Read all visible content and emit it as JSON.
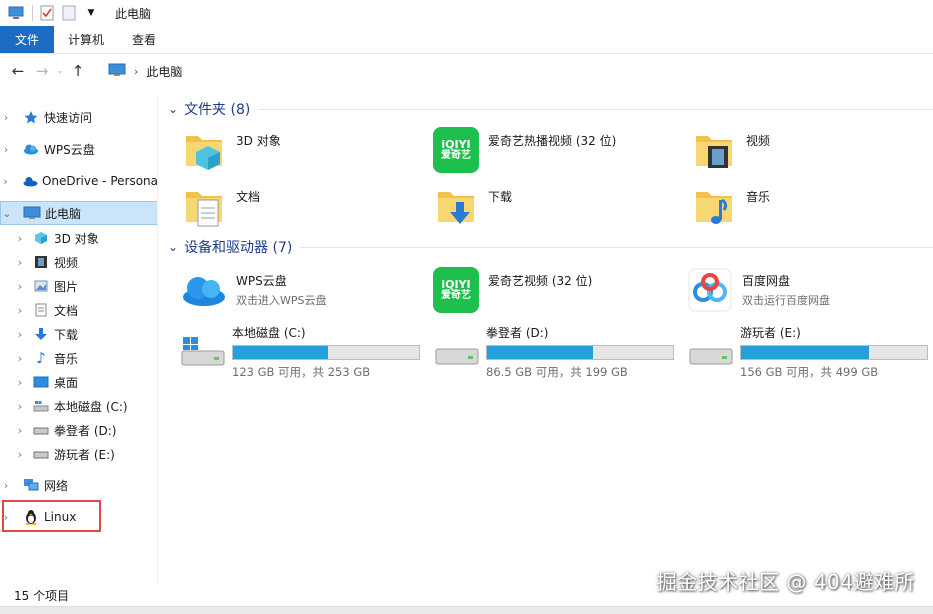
{
  "titlebar": {
    "title": "此电脑"
  },
  "ribbon": {
    "tabs": [
      "文件",
      "计算机",
      "查看"
    ]
  },
  "address": {
    "crumb": "此电脑"
  },
  "nav": {
    "items": [
      {
        "label": "快速访问"
      },
      {
        "label": "WPS云盘"
      },
      {
        "label": "OneDrive - Persona"
      },
      {
        "label": "此电脑"
      },
      {
        "label": "3D 对象"
      },
      {
        "label": "视频"
      },
      {
        "label": "图片"
      },
      {
        "label": "文档"
      },
      {
        "label": "下载"
      },
      {
        "label": "音乐"
      },
      {
        "label": "桌面"
      },
      {
        "label": "本地磁盘 (C:)"
      },
      {
        "label": "拳登者 (D:)"
      },
      {
        "label": "游玩者 (E:)"
      },
      {
        "label": "网络"
      },
      {
        "label": "Linux"
      }
    ]
  },
  "folders": {
    "title": "文件夹 (8)",
    "items": [
      {
        "label": "3D 对象"
      },
      {
        "label": "爱奇艺热播视频 (32 位)"
      },
      {
        "label": "视频"
      },
      {
        "label": "文档"
      },
      {
        "label": "下载"
      },
      {
        "label": "音乐"
      }
    ]
  },
  "devices": {
    "title": "设备和驱动器 (7)",
    "apps": [
      {
        "label": "WPS云盘",
        "sub": "双击进入WPS云盘"
      },
      {
        "label": "爱奇艺视频 (32 位)",
        "sub": ""
      },
      {
        "label": "百度网盘",
        "sub": "双击运行百度网盘"
      }
    ],
    "drives": [
      {
        "label": "本地磁盘 (C:)",
        "free": "123 GB 可用，共 253 GB",
        "used_fraction": 0.51
      },
      {
        "label": "拳登者 (D:)",
        "free": "86.5 GB 可用，共 199 GB",
        "used_fraction": 0.57
      },
      {
        "label": "游玩者 (E:)",
        "free": "156 GB 可用，共 499 GB",
        "used_fraction": 0.69
      }
    ]
  },
  "iqiyi": {
    "top": "iQIYI",
    "bottom": "爱奇艺"
  },
  "status": {
    "count": "15 个项目"
  },
  "watermark": "掘金技术社区 @ 404避难所",
  "colors": {
    "accent": "#1a6cc4",
    "bar": "#26a0da",
    "group": "#1e3d8f",
    "highlight": "#e04848"
  }
}
